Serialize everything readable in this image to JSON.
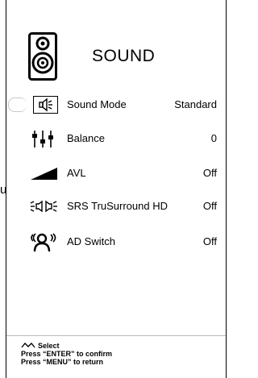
{
  "stray_text": "u",
  "menu": {
    "title": "SOUND",
    "title_icon": "speaker-icon",
    "items": [
      {
        "label": "Sound Mode",
        "value": "Standard",
        "icon": "speaker-mode-icon",
        "selected": true
      },
      {
        "label": "Balance",
        "value": "0",
        "icon": "balance-sliders-icon"
      },
      {
        "label": "AVL",
        "value": "Off",
        "icon": "volume-ramp-icon"
      },
      {
        "label": "SRS TruSurround HD",
        "value": "Off",
        "icon": "surround-sound-icon"
      },
      {
        "label": "AD Switch",
        "value": "Off",
        "icon": "audio-description-icon"
      }
    ]
  },
  "footer": {
    "select": "Select",
    "confirm": "Press “ENTER” to confirm",
    "return": "Press “MENU” to return",
    "select_icon": "navigation-arrows-icon"
  }
}
